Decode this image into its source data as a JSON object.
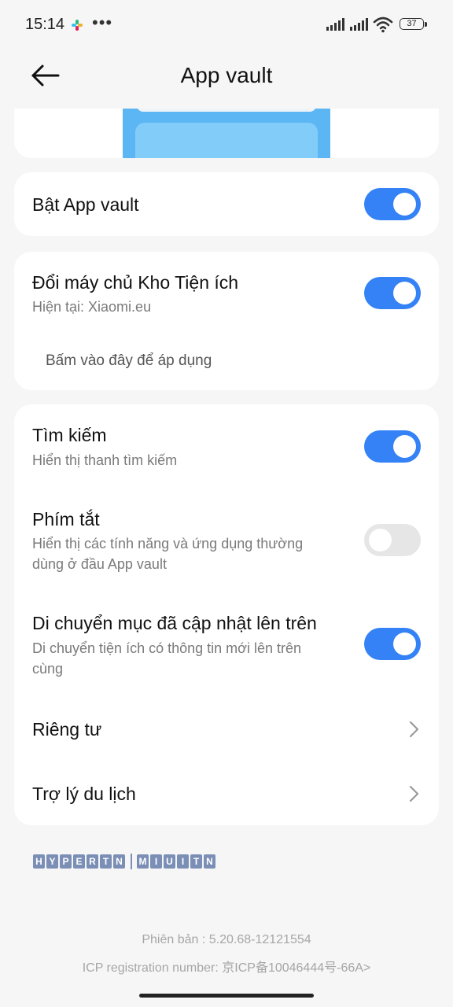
{
  "status_bar": {
    "time": "15:14",
    "dots": "•••",
    "battery": "37",
    "icons": [
      "app-notification-icon",
      "signal-icon",
      "signal-icon",
      "wifi-icon",
      "battery-icon"
    ]
  },
  "header": {
    "title": "App vault",
    "back_icon": "back-arrow-icon"
  },
  "enable": {
    "title": "Bật App vault",
    "toggle_on": true
  },
  "server": {
    "title": "Đổi máy chủ Kho Tiện ích",
    "subtitle": "Hiện tại: Xiaomi.eu",
    "apply_text": "Bấm vào đây để áp dụng",
    "toggle_on": true
  },
  "settings": {
    "search": {
      "title": "Tìm kiếm",
      "subtitle": "Hiển thị thanh tìm kiếm",
      "toggle_on": true
    },
    "shortcuts": {
      "title": "Phím tắt",
      "subtitle_line1": "Hiển thị các tính năng và ứng dụng thường",
      "subtitle_line2": "dùng ở đầu App vault",
      "toggle_on": false
    },
    "move_updated": {
      "title": "Di chuyển mục đã cập nhật lên trên",
      "subtitle_line1": "Di chuyển tiện ích có thông tin mới lên trên",
      "subtitle_line2": "cùng",
      "toggle_on": true
    },
    "privacy": {
      "title": "Riêng tư"
    },
    "travel": {
      "title": "Trợ lý du lịch"
    }
  },
  "logo": {
    "left": [
      "H",
      "Y",
      "P",
      "E",
      "R",
      "T",
      "N"
    ],
    "right": [
      "M",
      "I",
      "U",
      "I",
      "T",
      "N"
    ]
  },
  "footer": {
    "version": "Phiên bản :    5.20.68-12121554",
    "icp": "ICP registration number: 京ICP备10046444号-66A>"
  },
  "colors": {
    "accent": "#3482f6",
    "background": "#f6f6f6",
    "card": "#ffffff",
    "toggle_off": "#e6e6e6"
  }
}
